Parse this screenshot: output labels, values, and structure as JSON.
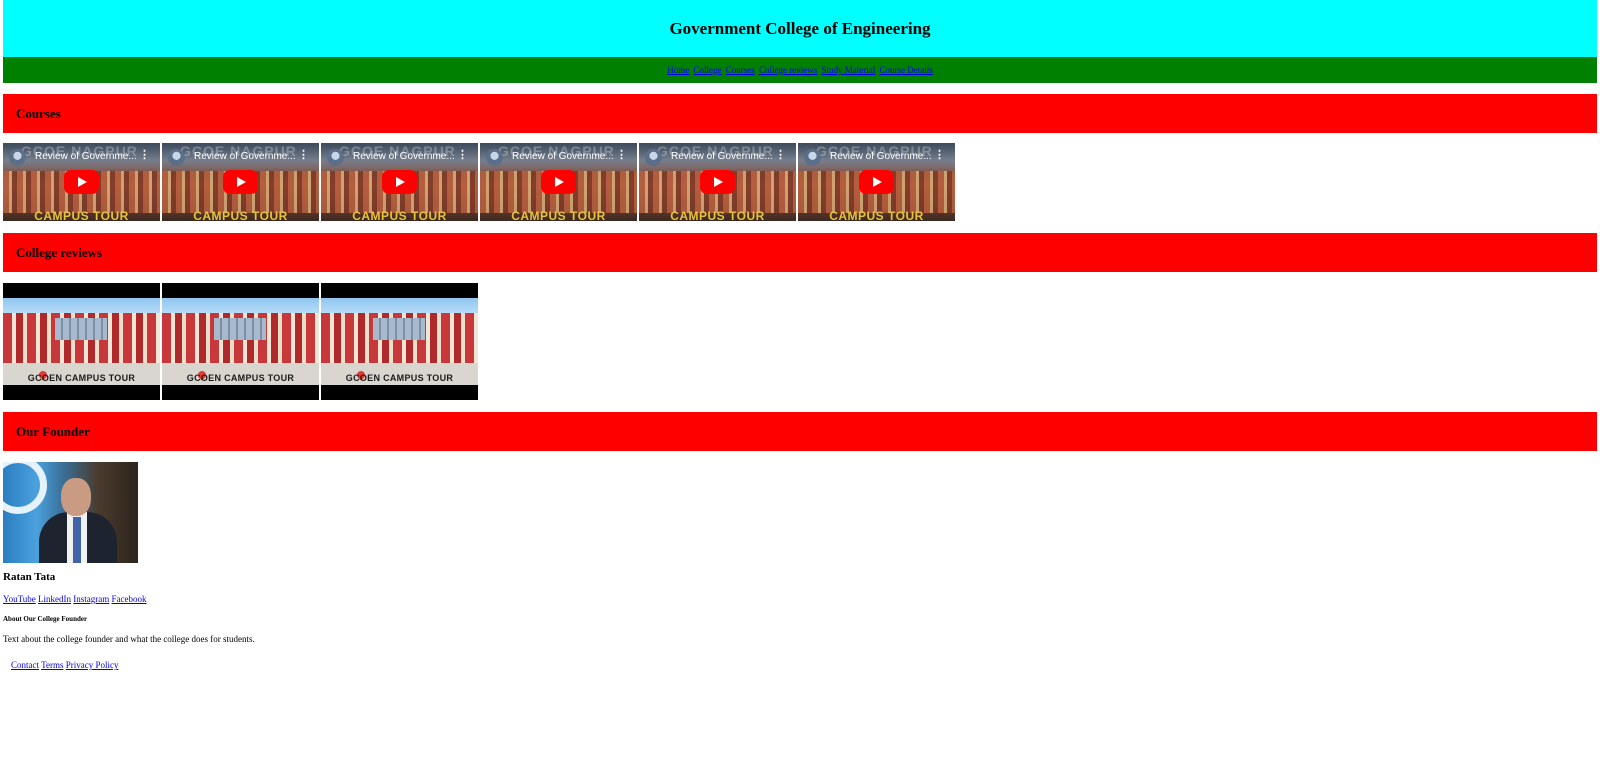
{
  "header": {
    "title": "Government College of Engineering"
  },
  "nav": {
    "items": [
      "Home",
      "College",
      "Courses",
      "College reviews",
      "Study Material",
      "Course Details"
    ]
  },
  "sections": {
    "courses": "Courses",
    "reviews": "College reviews",
    "founder": "Our Founder"
  },
  "videos": [
    {
      "title": "Review of Governme...",
      "watermark": "GCOE NAGPUR",
      "caption": "CAMPUS TOUR"
    },
    {
      "title": "Review of Governme...",
      "watermark": "GCOE NAGPUR",
      "caption": "CAMPUS TOUR"
    },
    {
      "title": "Review of Governme...",
      "watermark": "GCOE NAGPUR",
      "caption": "CAMPUS TOUR"
    },
    {
      "title": "Review of Governme...",
      "watermark": "GCOE NAGPUR",
      "caption": "CAMPUS TOUR"
    },
    {
      "title": "Review of Governme...",
      "watermark": "GCOE NAGPUR",
      "caption": "CAMPUS TOUR"
    },
    {
      "title": "Review of Governme...",
      "watermark": "GCOE NAGPUR",
      "caption": "CAMPUS TOUR"
    }
  ],
  "reviews": [
    {
      "caption": "GCOEN CAMPUS TOUR"
    },
    {
      "caption": "GCOEN CAMPUS TOUR"
    },
    {
      "caption": "GCOEN CAMPUS TOUR"
    }
  ],
  "founder": {
    "name": "Ratan Tata",
    "social": [
      "YouTube",
      "LinkedIn",
      "Instagram",
      "Facebook"
    ],
    "about_heading": "About Our College Founder",
    "about_text": "Text about the college founder and what the college does for students."
  },
  "footer": {
    "links": [
      "Contact",
      "Terms",
      "Privacy Policy"
    ]
  }
}
